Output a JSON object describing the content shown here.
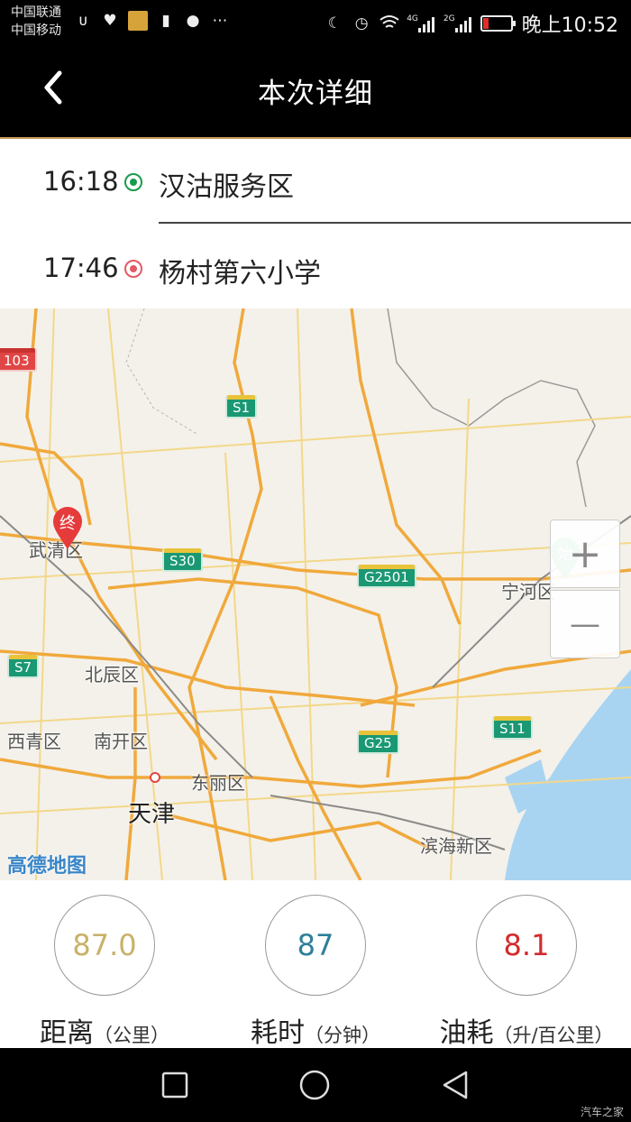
{
  "status_bar": {
    "carrier_1": "中国联通",
    "carrier_2": "中国移动",
    "network_1": "4G",
    "network_2": "2G",
    "time": "晚上10:52",
    "battery_color": "#e32b2b"
  },
  "header": {
    "title": "本次详细",
    "back_icon": "chevron-left-icon"
  },
  "trip": {
    "start": {
      "time": "16:18",
      "place": "汉沽服务区",
      "marker_color": "#1a9a4c"
    },
    "end": {
      "time": "17:46",
      "place": "杨村第六小学",
      "marker_color": "#e65862"
    }
  },
  "map": {
    "road_shields": [
      "103",
      "S1",
      "S30",
      "G2501",
      "S7",
      "G25",
      "S11"
    ],
    "place_labels": [
      "武清区",
      "北辰区",
      "西青区",
      "南开区",
      "东丽区",
      "天津",
      "宁河区",
      "滨海新区"
    ],
    "end_pin_label": "终",
    "start_pin_label": "始",
    "provider_logo": "高德地图",
    "zoom_in_symbol": "+",
    "zoom_out_symbol": "—",
    "water_color": "#a8d4f2",
    "road_color": "#f0a93c"
  },
  "stats": {
    "distance": {
      "value": "87.0",
      "label": "距离",
      "unit": "（公里）",
      "color": "#c9b168"
    },
    "duration": {
      "value": "87",
      "label": "耗时",
      "unit": "（分钟）",
      "color": "#2e7f9a"
    },
    "fuel": {
      "value": "8.1",
      "label": "油耗",
      "unit": "（升/百公里）",
      "color": "#d42a2a"
    }
  },
  "nav_bar": {
    "icons": [
      "recent-apps-square-icon",
      "home-circle-icon",
      "back-triangle-icon"
    ],
    "watermark": "汽车之家"
  }
}
